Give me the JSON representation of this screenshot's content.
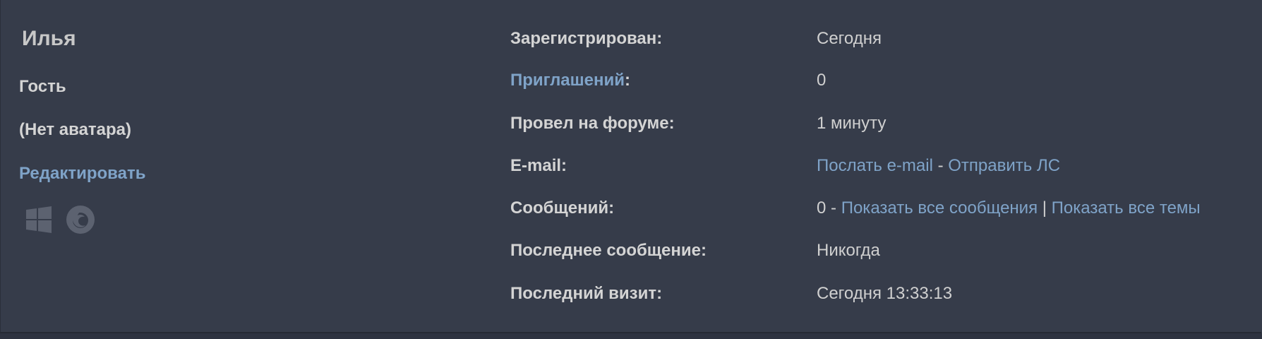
{
  "profile": {
    "username": "Илья",
    "rank": "Гость",
    "avatar_text": "(Нет аватара)",
    "edit_label": "Редактировать",
    "icons": [
      "windows-icon",
      "firefox-icon"
    ]
  },
  "details": {
    "registered": {
      "label": "Зарегистрирован:",
      "value": "Сегодня"
    },
    "invites": {
      "label_link": "Приглашений",
      "label_suffix": ":",
      "value": "0"
    },
    "time_on_forum": {
      "label": "Провел на форуме:",
      "value": "1 минуту"
    },
    "email": {
      "label": "E-mail:",
      "send_email": "Послать e-mail",
      "separator": " - ",
      "send_pm": "Отправить ЛС"
    },
    "posts": {
      "label": "Сообщений:",
      "count": "0",
      "separator": " - ",
      "show_posts": "Показать все сообщения",
      "pipe": " | ",
      "show_topics": "Показать все темы"
    },
    "last_post": {
      "label": "Последнее сообщение:",
      "value": "Никогда"
    },
    "last_visit": {
      "label": "Последний визит:",
      "value": "Сегодня 13:33:13"
    }
  },
  "colors": {
    "background": "#363c4a",
    "text": "#d4d4d4",
    "link": "#7fa3c8",
    "icon": "#5c6270"
  }
}
